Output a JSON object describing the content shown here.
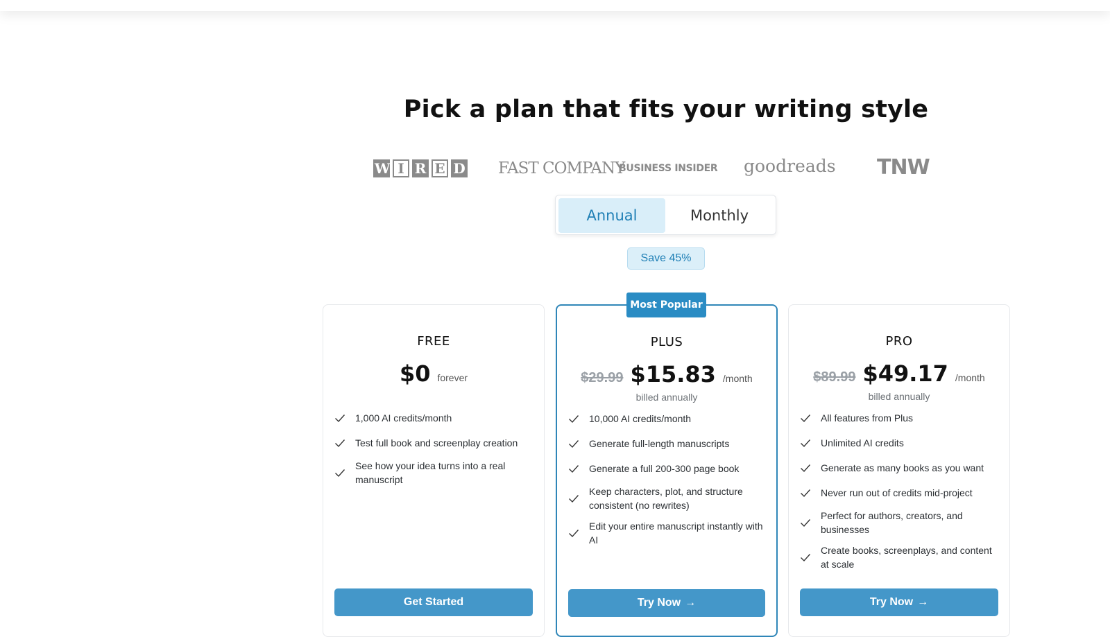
{
  "headline": "Pick a plan that fits your writing style",
  "press_logos": {
    "wired": [
      "W",
      "I",
      "R",
      "E",
      "D"
    ],
    "fast_company": "FAST COMPANY",
    "business_insider": "BUSINESS INSIDER",
    "goodreads": "goodreads",
    "tnw": "TNW"
  },
  "billing_toggle": {
    "annual_label": "Annual",
    "monthly_label": "Monthly",
    "selected": "Annual"
  },
  "save_badge": "Save 45%",
  "plans": [
    {
      "name": "FREE",
      "price": "$0",
      "period": "forever",
      "old_price": "",
      "billed": "",
      "features": [
        "1,000 AI credits/month",
        "Test full book and screenplay creation",
        "See how your idea turns into a real manuscript"
      ],
      "cta": "Get Started"
    },
    {
      "name": "PLUS",
      "badge": "Most Popular",
      "old_price": "$29.99",
      "price": "$15.83",
      "period": "/month",
      "billed": "billed annually",
      "features": [
        "10,000 AI credits/month",
        "Generate full-length manuscripts",
        "Generate a full 200-300 page book",
        "Keep characters, plot, and structure consistent (no rewrites)",
        "Edit your entire manuscript instantly with AI"
      ],
      "cta": "Try Now"
    },
    {
      "name": "PRO",
      "old_price": "$89.99",
      "price": "$49.17",
      "period": "/month",
      "billed": "billed annually",
      "features": [
        "All features from Plus",
        "Unlimited AI credits",
        "Generate as many books as you want",
        "Never run out of credits mid-project",
        "Perfect for authors, creators, and businesses",
        "Create books, screenplays, and content at scale"
      ],
      "cta": "Try Now"
    }
  ],
  "colors": {
    "accent": "#2a8cc4",
    "cta": "#4497c9",
    "toggle_selected_bg": "#d9eef9"
  },
  "icons": {
    "feature": "check-icon",
    "cta_arrow": "arrow-right-icon"
  }
}
